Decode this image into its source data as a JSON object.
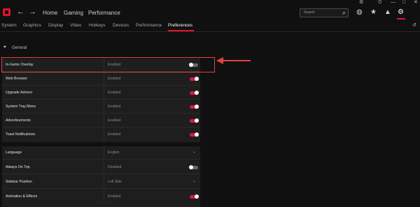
{
  "window": {
    "controls": [
      "⚙",
      "⏱",
      "—",
      "□",
      "✕"
    ]
  },
  "header": {
    "nav": [
      "Home",
      "Gaming",
      "Performance"
    ],
    "search_placeholder": "Search",
    "back_icon": "arrow-left-icon",
    "forward_icon": "arrow-right-icon"
  },
  "subtabs": [
    "System",
    "Graphics",
    "Display",
    "Video",
    "Hotkeys",
    "Devices",
    "Performance",
    "Preferences"
  ],
  "active_subtab": "Preferences",
  "general": {
    "title": "General",
    "rows": [
      {
        "label": "In-Game Overlay",
        "value": "Enabled",
        "toggle": "off"
      },
      {
        "label": "Web Browser",
        "value": "Enabled",
        "toggle": "on"
      },
      {
        "label": "Upgrade Advisor",
        "value": "Enabled",
        "toggle": "on"
      },
      {
        "label": "System Tray Menu",
        "value": "Enabled",
        "toggle": "on"
      },
      {
        "label": "Advertisements",
        "value": "Enabled",
        "toggle": "on"
      },
      {
        "label": "Toast Notifications",
        "value": "Enabled",
        "toggle": "on"
      }
    ]
  },
  "other": {
    "rows": [
      {
        "label": "Language",
        "value": "English",
        "control": "dropdown"
      },
      {
        "label": "Always On Top",
        "value": "Disabled",
        "control": "toggle-off"
      },
      {
        "label": "Sidebar Position",
        "value": "Left Side",
        "control": "dropdown"
      },
      {
        "label": "Animation & Effects",
        "value": "Enabled",
        "control": "toggle-on"
      }
    ]
  },
  "colors": {
    "accent": "#e5102c",
    "annotation": "#e0463e",
    "toggle_on": "#d91a3b"
  }
}
